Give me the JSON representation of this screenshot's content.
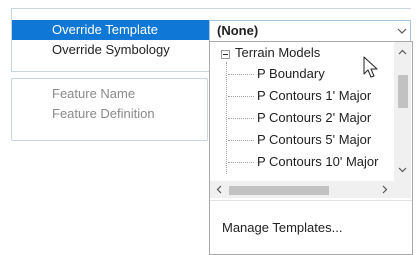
{
  "properties": {
    "override_template": {
      "label": "Override Template",
      "value": "(None)"
    },
    "override_symbology": {
      "label": "Override Symbology"
    },
    "feature_name": {
      "label": "Feature Name"
    },
    "feature_definition": {
      "label": "Feature Definition"
    }
  },
  "dropdown": {
    "tree": [
      {
        "label": "Terrain Models",
        "expanded": true
      },
      {
        "label": "P Boundary"
      },
      {
        "label": "P Contours 1' Major"
      },
      {
        "label": "P Contours 2' Major"
      },
      {
        "label": "P Contours 5' Major"
      },
      {
        "label": "P Contours 10' Major"
      }
    ],
    "manage_label": "Manage Templates..."
  },
  "colors": {
    "selection": "#0f78d6",
    "border": "#a9c4dd"
  }
}
